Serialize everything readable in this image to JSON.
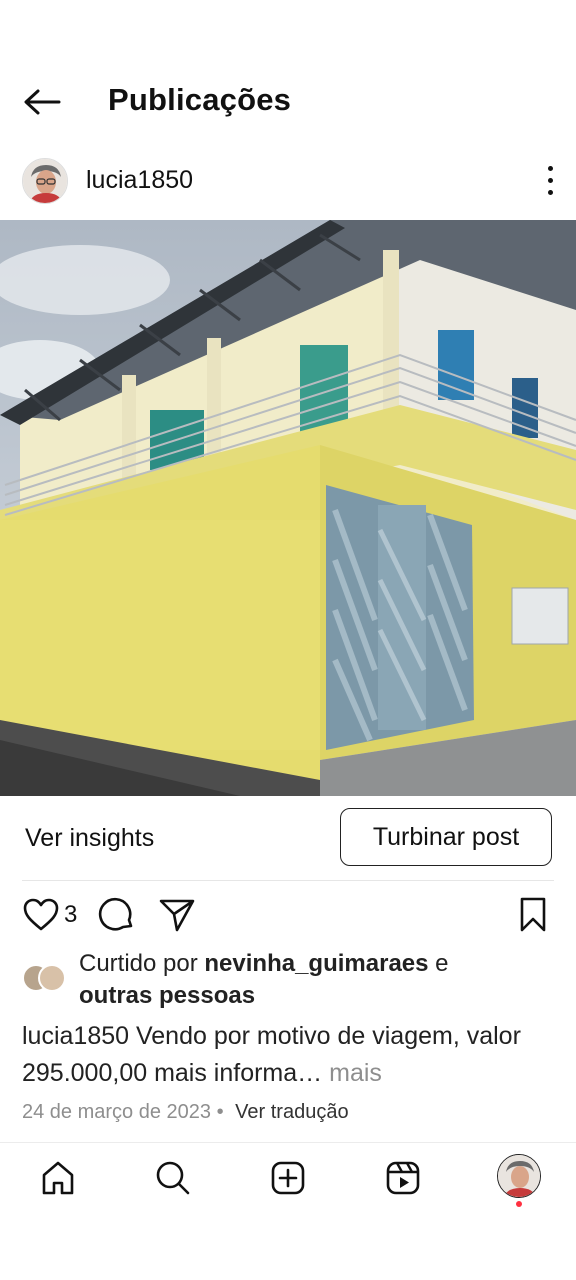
{
  "header": {
    "title": "Publicações"
  },
  "post": {
    "username": "lucia1850",
    "insights_label": "Ver insights",
    "boost_label": "Turbinar post",
    "like_count": "3",
    "liked_prefix": "Curtido por ",
    "liked_user": "nevinha_guimaraes",
    "liked_connector": " e ",
    "liked_suffix": "outras pessoas",
    "caption_user": "lucia1850",
    "caption_text": " Vendo por motivo de viagem, valor 295.000,00 mais informa…",
    "caption_more": " mais",
    "date": "24 de março de 2023",
    "separator": " • ",
    "translate_label": "Ver tradução"
  },
  "icons": {
    "back": "arrow-left-icon",
    "more": "more-vertical-icon",
    "like": "heart-icon",
    "comment": "comment-icon",
    "share": "send-icon",
    "save": "bookmark-icon",
    "home": "home-icon",
    "search": "search-icon",
    "create": "add-icon",
    "reels": "reels-icon"
  },
  "colors": {
    "notification_dot": "#ff3040",
    "secondary_text": "#8e8e8e"
  }
}
